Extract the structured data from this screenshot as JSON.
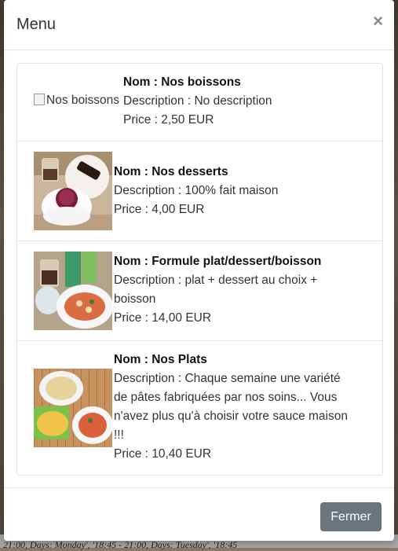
{
  "background": {
    "bottom_text": "21:00, Days: Monday', '18:45 - 21:00, Days: Tuesday', '18:45"
  },
  "modal": {
    "title": "Menu",
    "close_symbol": "×",
    "footer": {
      "close_label": "Fermer"
    },
    "items": [
      {
        "name": "Nom : Nos boissons",
        "description": "Description : No description",
        "price": "Price : 2,50 EUR",
        "image_alt": "Nos boissons",
        "image": "broken"
      },
      {
        "name": "Nom : Nos desserts",
        "description": "Description : 100% fait maison",
        "price": "Price : 4,00 EUR",
        "image": "desserts-photo"
      },
      {
        "name": "Nom : Formule plat/dessert/boisson",
        "description_line1": "Description : plat + dessert au choix +",
        "description_line2": "boisson",
        "price": "Price : 14,00 EUR",
        "image": "formula-photo"
      },
      {
        "name": "Nom : Nos Plats",
        "description_line1": "Description : Chaque semaine une variété",
        "description_line2": "de pâtes fabriquées par nos soins... Vous",
        "description_line3": "n'avez plus qu'à choisir votre sauce maison",
        "description_line4": "!!!",
        "price": "Price : 10,40 EUR",
        "image": "pasta-photo"
      }
    ]
  }
}
